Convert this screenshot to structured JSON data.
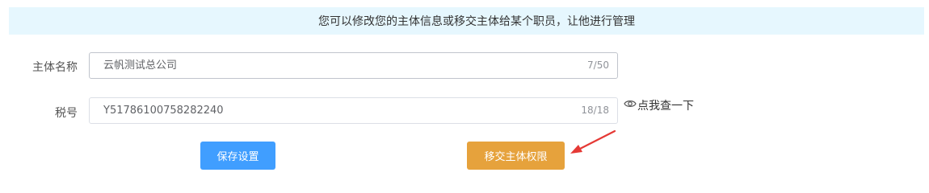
{
  "notice": {
    "text": "您可以修改您的主体信息或移交主体给某个职员，让他进行管理"
  },
  "form": {
    "entity_name": {
      "label": "主体名称",
      "value": "云帆测试总公司",
      "count": "7/50"
    },
    "tax_id": {
      "label": "税号",
      "value": "Y51786100758282240",
      "count": "18/18",
      "check_link": "点我查一下"
    }
  },
  "buttons": {
    "save": "保存设置",
    "transfer": "移交主体权限"
  },
  "colors": {
    "notice_bg": "#e6f7fe",
    "primary": "#409eff",
    "warning": "#e6a23c",
    "annotation_arrow": "#e53935"
  },
  "icons": {
    "check_link_icon": "eye-icon",
    "annotation": "red-arrow-icon"
  }
}
